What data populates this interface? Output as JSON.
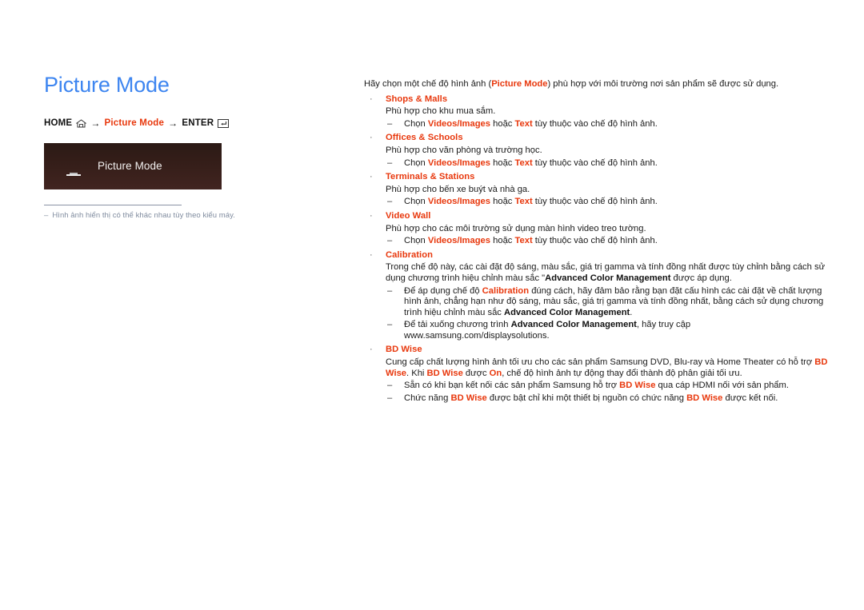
{
  "page": {
    "title": "Picture Mode",
    "title_color": "#3d85f0",
    "accent_color": "#e8380d"
  },
  "breadcrumb": {
    "home_label": "HOME",
    "home_icon": "home-icon",
    "arrow1": "→",
    "menu_label": "Picture Mode",
    "arrow2": "→",
    "enter_label": "ENTER",
    "enter_icon": "enter-key-icon"
  },
  "osd": {
    "icon": "monitor-icon",
    "label": "Picture Mode"
  },
  "note": {
    "dash": "–",
    "text": "Hình ảnh hiển thị có thể khác nhau tùy theo kiểu máy."
  },
  "content": {
    "intro": {
      "part1": "Hãy chọn một chế độ hình ảnh (",
      "keyword": "Picture Mode",
      "part2": ") phù hợp với môi trường nơi sản phẩm sẽ được sử dụng."
    },
    "bullet_marker": "·",
    "dash_marker": "–",
    "sections": [
      {
        "title": "Shops & Malls",
        "body": "Phù hợp cho khu mua sắm.",
        "sub": {
          "p1": "Chọn ",
          "kw1": "Videos/Images",
          "p2": " hoặc ",
          "kw2": "Text",
          "p3": " tùy thuộc vào chế độ hình ảnh."
        }
      },
      {
        "title": "Offices & Schools",
        "body": "Phù hợp cho văn phòng và trường học.",
        "sub": {
          "p1": "Chọn ",
          "kw1": "Videos/Images",
          "p2": " hoặc ",
          "kw2": "Text",
          "p3": " tùy thuộc vào chế độ hình ảnh."
        }
      },
      {
        "title": "Terminals & Stations",
        "body": "Phù hợp cho bến xe buýt và nhà ga.",
        "sub": {
          "p1": "Chọn ",
          "kw1": "Videos/Images",
          "p2": " hoặc ",
          "kw2": "Text",
          "p3": " tùy thuộc vào chế độ hình ảnh."
        }
      },
      {
        "title": "Video Wall",
        "body": "Phù hợp cho các môi trường sử dụng màn hình video treo tường.",
        "sub": {
          "p1": "Chọn ",
          "kw1": "Videos/Images",
          "p2": " hoặc ",
          "kw2": "Text",
          "p3": " tùy thuộc vào chế độ hình ảnh."
        }
      }
    ],
    "calibration": {
      "title": "Calibration",
      "body_p1": "Trong chế độ này, các cài đặt độ sáng, màu sắc, giá trị gamma và tính đồng nhất được tùy chỉnh bằng cách sử dụng chương trình hiệu chỉnh màu sắc \"",
      "body_bold": "Advanced Color Management",
      "body_p2": " được áp dụng.",
      "sub1_p1": "Để áp dụng chế độ ",
      "sub1_kw": "Calibration",
      "sub1_p2": " đúng cách, hãy đảm bảo rằng bạn đặt cấu hình các cài đặt về chất lượng hình ảnh, chẳng hạn như độ sáng, màu sắc, giá trị gamma và tính đồng nhất, bằng cách sử dụng chương trình hiệu chỉnh màu sắc ",
      "sub1_bold": "Advanced Color Management",
      "sub1_p3": ".",
      "sub2_p1": "Để tải xuống chương trình ",
      "sub2_bold": "Advanced Color Management",
      "sub2_p2": ", hãy truy cập www.samsung.com/displaysolutions."
    },
    "bdwise": {
      "title": "BD Wise",
      "body_p1": "Cung cấp chất lượng hình ảnh tối ưu cho các sản phẩm Samsung DVD, Blu-ray và Home Theater có hỗ trợ ",
      "kw1": "BD Wise",
      "body_p2": ". Khi ",
      "kw2": "BD Wise",
      "body_p3": " được ",
      "kw3": "On",
      "body_p4": ", chế độ hình ảnh tự động thay đổi thành độ phân giải tối ưu.",
      "sub1_p1": "Sẵn có khi bạn kết nối các sản phẩm Samsung hỗ trợ ",
      "sub1_kw": "BD Wise",
      "sub1_p2": " qua cáp HDMI nối với sản phẩm.",
      "sub2_p1": "Chức năng ",
      "sub2_kw1": "BD Wise",
      "sub2_p2": " được bật chỉ khi một thiết bị nguồn có chức năng ",
      "sub2_kw2": "BD Wise",
      "sub2_p3": " được kết nối."
    }
  }
}
